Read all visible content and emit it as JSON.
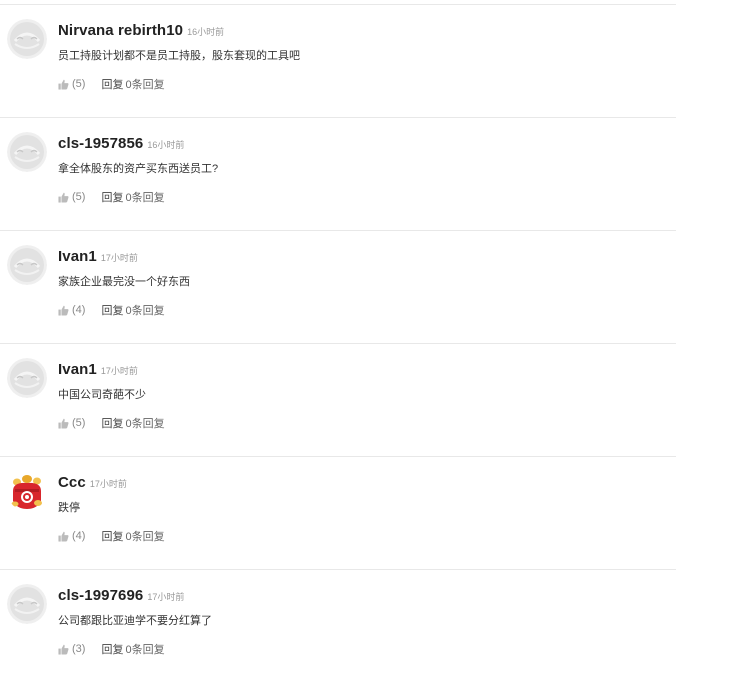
{
  "comments": [
    {
      "username": "Nirvana rebirth10",
      "time": "16小时前",
      "content": "员工持股计划都不是员工持股，股东套现的工具吧",
      "like_count": "(5)",
      "reply_label": "回复",
      "reply_count": "0条回复",
      "avatar": "default-avatar-icon"
    },
    {
      "username": "cls-1957856",
      "time": "16小时前",
      "content": "拿全体股东的资产买东西送员工?",
      "like_count": "(5)",
      "reply_label": "回复",
      "reply_count": "0条回复",
      "avatar": "default-avatar-icon"
    },
    {
      "username": "Ivan1",
      "time": "17小时前",
      "content": "家族企业最完没一个好东西",
      "like_count": "(4)",
      "reply_label": "回复",
      "reply_count": "0条回复",
      "avatar": "default-avatar-icon"
    },
    {
      "username": "Ivan1",
      "time": "17小时前",
      "content": "中国公司奇葩不少",
      "like_count": "(5)",
      "reply_label": "回复",
      "reply_count": "0条回复",
      "avatar": "default-avatar-icon"
    },
    {
      "username": "Ccc",
      "time": "17小时前",
      "content": "跌停",
      "like_count": "(4)",
      "reply_label": "回复",
      "reply_count": "0条回复",
      "avatar": "fortune-bag-avatar-icon"
    },
    {
      "username": "cls-1997696",
      "time": "17小时前",
      "content": "公司都跟比亚迪学不要分红算了",
      "like_count": "(3)",
      "reply_label": "回复",
      "reply_count": "0条回复",
      "avatar": "default-avatar-icon"
    }
  ],
  "colors": {
    "divider": "#e8e8e8",
    "username": "#222222",
    "time": "#999999",
    "icon_gray": "#bbbbbb",
    "avatar_red": "#d8262c",
    "avatar_gold": "#f2c14e"
  }
}
